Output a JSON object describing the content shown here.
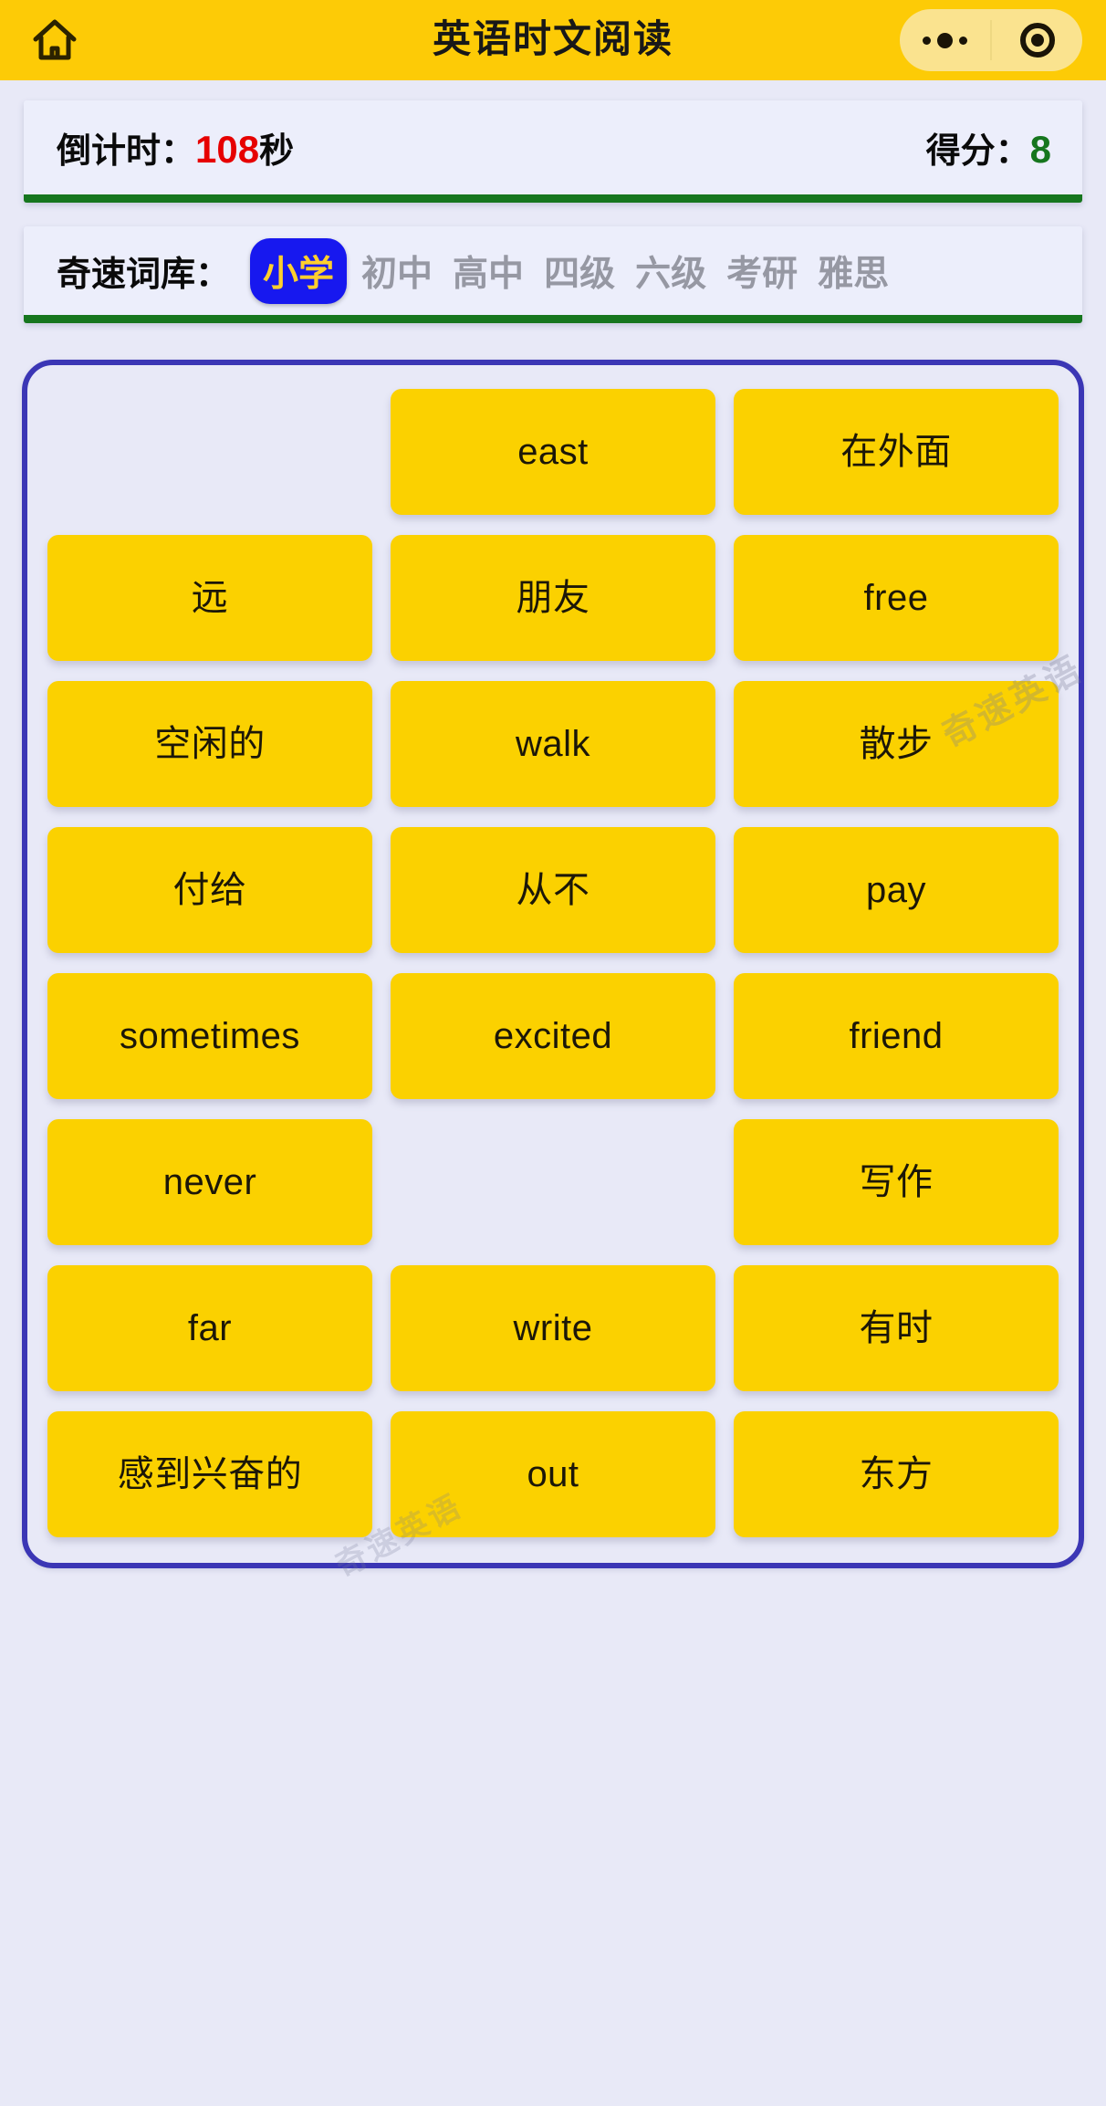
{
  "header": {
    "home_icon": "home-icon",
    "title": "英语时文阅读",
    "capsule": {
      "more_icon": "more-dots-icon",
      "target_icon": "target-circle-icon"
    }
  },
  "status": {
    "countdown_label": "倒计时：",
    "countdown_value": "108",
    "countdown_unit": "秒",
    "score_label": "得分：",
    "score_value": "8",
    "countdown_color": "#e60000",
    "score_color": "#16761e"
  },
  "levels": {
    "label": "奇速词库：",
    "items": [
      {
        "name": "小学",
        "selected": true
      },
      {
        "name": "初中",
        "selected": false
      },
      {
        "name": "高中",
        "selected": false
      },
      {
        "name": "四级",
        "selected": false
      },
      {
        "name": "六级",
        "selected": false
      },
      {
        "name": "考研",
        "selected": false
      },
      {
        "name": "雅思",
        "selected": false
      }
    ],
    "active_bg": "#1718ef",
    "active_text": "#ffcf2e",
    "inactive_text": "#9698a3"
  },
  "grid": {
    "columns": 3,
    "border_color": "#3b36b5",
    "card_color": "#fbd100",
    "cards": [
      {
        "text": "",
        "empty": true
      },
      {
        "text": "east",
        "empty": false
      },
      {
        "text": "在外面",
        "empty": false
      },
      {
        "text": "远",
        "empty": false
      },
      {
        "text": "朋友",
        "empty": false
      },
      {
        "text": "free",
        "empty": false
      },
      {
        "text": "空闲的",
        "empty": false
      },
      {
        "text": "walk",
        "empty": false
      },
      {
        "text": "散步",
        "empty": false
      },
      {
        "text": "付给",
        "empty": false
      },
      {
        "text": "从不",
        "empty": false
      },
      {
        "text": "pay",
        "empty": false
      },
      {
        "text": "sometimes",
        "empty": false
      },
      {
        "text": "excited",
        "empty": false
      },
      {
        "text": "friend",
        "empty": false
      },
      {
        "text": "never",
        "empty": false
      },
      {
        "text": "",
        "empty": true
      },
      {
        "text": "写作",
        "empty": false
      },
      {
        "text": "far",
        "empty": false
      },
      {
        "text": "write",
        "empty": false
      },
      {
        "text": "有时",
        "empty": false
      },
      {
        "text": "感到兴奋的",
        "empty": false
      },
      {
        "text": "out",
        "empty": false
      },
      {
        "text": "东方",
        "empty": false
      }
    ]
  },
  "watermarks": [
    {
      "text": "奇速英语"
    },
    {
      "text": "奇速英语"
    }
  ],
  "theme": {
    "navbar_bg": "#fdcb06",
    "page_bg": "#e8e9f7",
    "panel_bg": "#eceefb",
    "panel_underline": "#16761e"
  }
}
